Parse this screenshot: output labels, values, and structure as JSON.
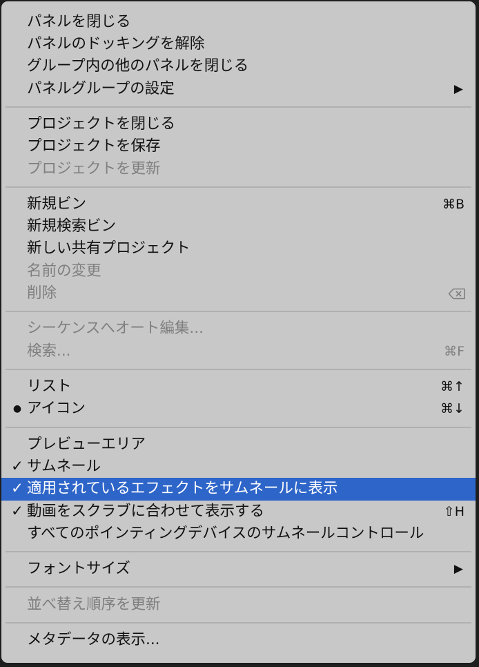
{
  "menu": {
    "close_panel": "パネルを閉じる",
    "undock_panel": "パネルのドッキングを解除",
    "close_other_panels": "グループ内の他のパネルを閉じる",
    "panel_group_settings": "パネルグループの設定",
    "close_project": "プロジェクトを閉じる",
    "save_project": "プロジェクトを保存",
    "refresh_project": "プロジェクトを更新",
    "new_bin": "新規ビン",
    "new_bin_shortcut": "⌘B",
    "new_search_bin": "新規検索ビン",
    "new_shared_project": "新しい共有プロジェクト",
    "rename": "名前の変更",
    "delete": "削除",
    "automate_to_sequence": "シーケンスへオート編集...",
    "find": "検索...",
    "find_shortcut": "⌘F",
    "list": "リスト",
    "list_shortcut": "⌘↑",
    "icon": "アイコン",
    "icon_shortcut": "⌘↓",
    "preview_area": "プレビューエリア",
    "thumbnails": "サムネール",
    "show_effects_on_thumbnails": "適用されているエフェクトをサムネールに表示",
    "hover_scrub": "動画をスクラブに合わせて表示する",
    "hover_scrub_shortcut": "⇧H",
    "all_pointing_devices": "すべてのポインティングデバイスのサムネールコントロール",
    "font_size": "フォントサイズ",
    "refresh_sort": "並べ替え順序を更新",
    "metadata_display": "メタデータの表示..."
  },
  "glyphs": {
    "check": "✓",
    "bullet": "●",
    "submenu_arrow": "▶"
  },
  "icons": {
    "delete_shortcut_icon": "backspace-icon"
  }
}
